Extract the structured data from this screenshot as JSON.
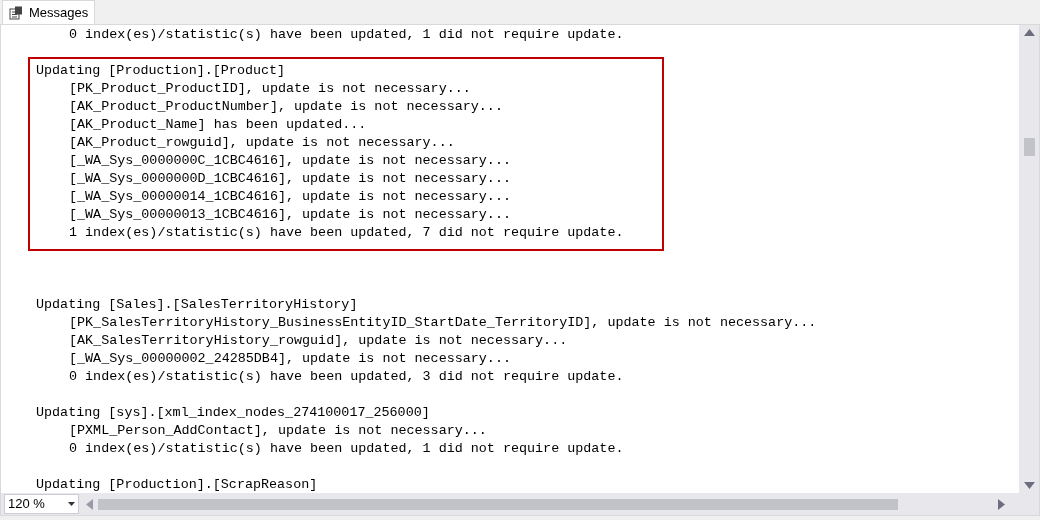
{
  "tab": {
    "label": "Messages",
    "selected": true
  },
  "blocks": [
    {
      "highlighted": false,
      "lines": [
        {
          "kind": "item",
          "text": "0 index(es)/statistic(s) have been updated, 1 did not require update."
        }
      ]
    },
    {
      "highlighted": true,
      "lines": [
        {
          "kind": "header",
          "text": "Updating [Production].[Product]"
        },
        {
          "kind": "item",
          "text": "[PK_Product_ProductID], update is not necessary..."
        },
        {
          "kind": "item",
          "text": "[AK_Product_ProductNumber], update is not necessary..."
        },
        {
          "kind": "item",
          "text": "[AK_Product_Name] has been updated..."
        },
        {
          "kind": "item",
          "text": "[AK_Product_rowguid], update is not necessary..."
        },
        {
          "kind": "item",
          "text": "[_WA_Sys_0000000C_1CBC4616], update is not necessary..."
        },
        {
          "kind": "item",
          "text": "[_WA_Sys_0000000D_1CBC4616], update is not necessary..."
        },
        {
          "kind": "item",
          "text": "[_WA_Sys_00000014_1CBC4616], update is not necessary..."
        },
        {
          "kind": "item",
          "text": "[_WA_Sys_00000013_1CBC4616], update is not necessary..."
        },
        {
          "kind": "item",
          "text": "1 index(es)/statistic(s) have been updated, 7 did not require update."
        }
      ]
    },
    {
      "highlighted": false,
      "lines": [
        {
          "kind": "header",
          "text": "Updating [Sales].[SalesTerritoryHistory]"
        },
        {
          "kind": "item",
          "text": "[PK_SalesTerritoryHistory_BusinessEntityID_StartDate_TerritoryID], update is not necessary..."
        },
        {
          "kind": "item",
          "text": "[AK_SalesTerritoryHistory_rowguid], update is not necessary..."
        },
        {
          "kind": "item",
          "text": "[_WA_Sys_00000002_24285DB4], update is not necessary..."
        },
        {
          "kind": "item",
          "text": "0 index(es)/statistic(s) have been updated, 3 did not require update."
        }
      ]
    },
    {
      "highlighted": false,
      "lines": [
        {
          "kind": "header",
          "text": "Updating [sys].[xml_index_nodes_274100017_256000]"
        },
        {
          "kind": "item",
          "text": "[PXML_Person_AddContact], update is not necessary..."
        },
        {
          "kind": "item",
          "text": "0 index(es)/statistic(s) have been updated, 1 did not require update."
        }
      ]
    },
    {
      "highlighted": false,
      "lines": [
        {
          "kind": "header",
          "text": "Updating [Production].[ScrapReason]"
        }
      ]
    }
  ],
  "zoom": "120 %"
}
